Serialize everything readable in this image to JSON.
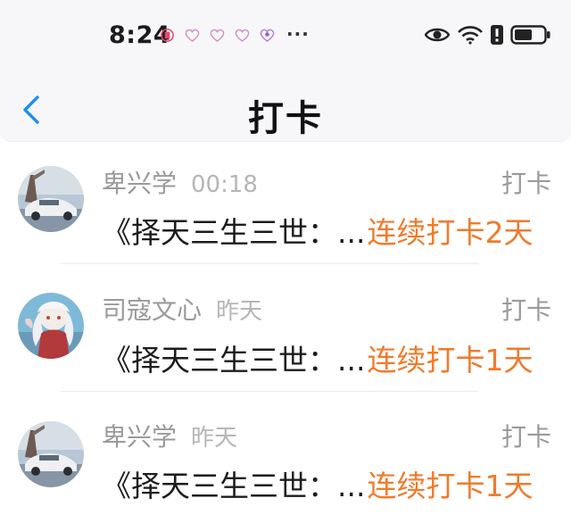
{
  "status_bar": {
    "time": "8:24",
    "more": "···",
    "notification_icons": [
      "notification-badge-icon",
      "heart-outline-icon",
      "heart-outline-icon",
      "heart-outline-icon",
      "heart-sparkle-icon"
    ],
    "system_icons": [
      "eye-icon",
      "wifi-icon",
      "alert-icon",
      "battery-icon"
    ]
  },
  "nav": {
    "back_icon": "chevron-left-icon",
    "title": "打卡"
  },
  "colors": {
    "accent_back": "#1e8ff0",
    "streak": "#ef7b2c",
    "muted": "#9a9a9a"
  },
  "items": [
    {
      "name": "卑兴学",
      "stamp": "00:18",
      "action": "打卡",
      "book": "《择天三生三世：...",
      "streak": "连续打卡2天",
      "avatar": "car-photo-avatar"
    },
    {
      "name": "司寇文心",
      "stamp": "昨天",
      "action": "打卡",
      "book": "《择天三生三世：...",
      "streak": "连续打卡1天",
      "avatar": "anime-girl-avatar"
    },
    {
      "name": "卑兴学",
      "stamp": "昨天",
      "action": "打卡",
      "book": "《择天三生三世：...",
      "streak": "连续打卡1天",
      "avatar": "car-photo-avatar"
    }
  ]
}
